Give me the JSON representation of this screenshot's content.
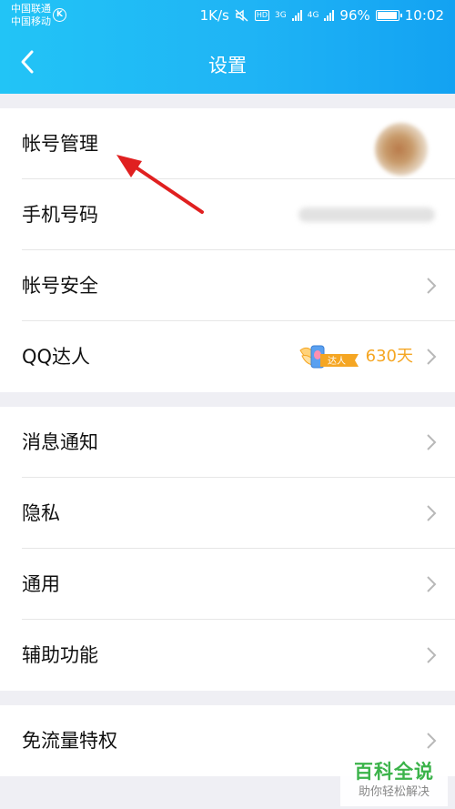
{
  "status_bar": {
    "carrier_1": "中国联通",
    "carrier_2": "中国移动",
    "k_badge": "K",
    "speed": "1K/s",
    "hd": "HD",
    "net_1": "3G",
    "net_2": "4G",
    "battery": "96%",
    "battery_level": 0.96,
    "time": "10:02"
  },
  "header": {
    "title": "设置",
    "back_icon": "chevron-left-icon"
  },
  "groups": [
    {
      "items": [
        {
          "label": "帐号管理"
        },
        {
          "label": "手机号码"
        },
        {
          "label": "帐号安全"
        },
        {
          "label": "QQ达人",
          "badge_text": "达人",
          "value": "630天"
        }
      ]
    },
    {
      "items": [
        {
          "label": "消息通知"
        },
        {
          "label": "隐私"
        },
        {
          "label": "通用"
        },
        {
          "label": "辅助功能"
        }
      ]
    },
    {
      "items": [
        {
          "label": "免流量特权"
        }
      ]
    }
  ],
  "annotation": {
    "color": "#e02020",
    "icon": "red-arrow-annotation"
  },
  "watermark": {
    "title": "百科全说",
    "subtitle": "助你轻松解决",
    "color": "#3bb34a"
  },
  "colors": {
    "header_start": "#22c4f6",
    "header_end": "#13a2f2",
    "background": "#efeff4",
    "accent_orange": "#f5a623"
  }
}
